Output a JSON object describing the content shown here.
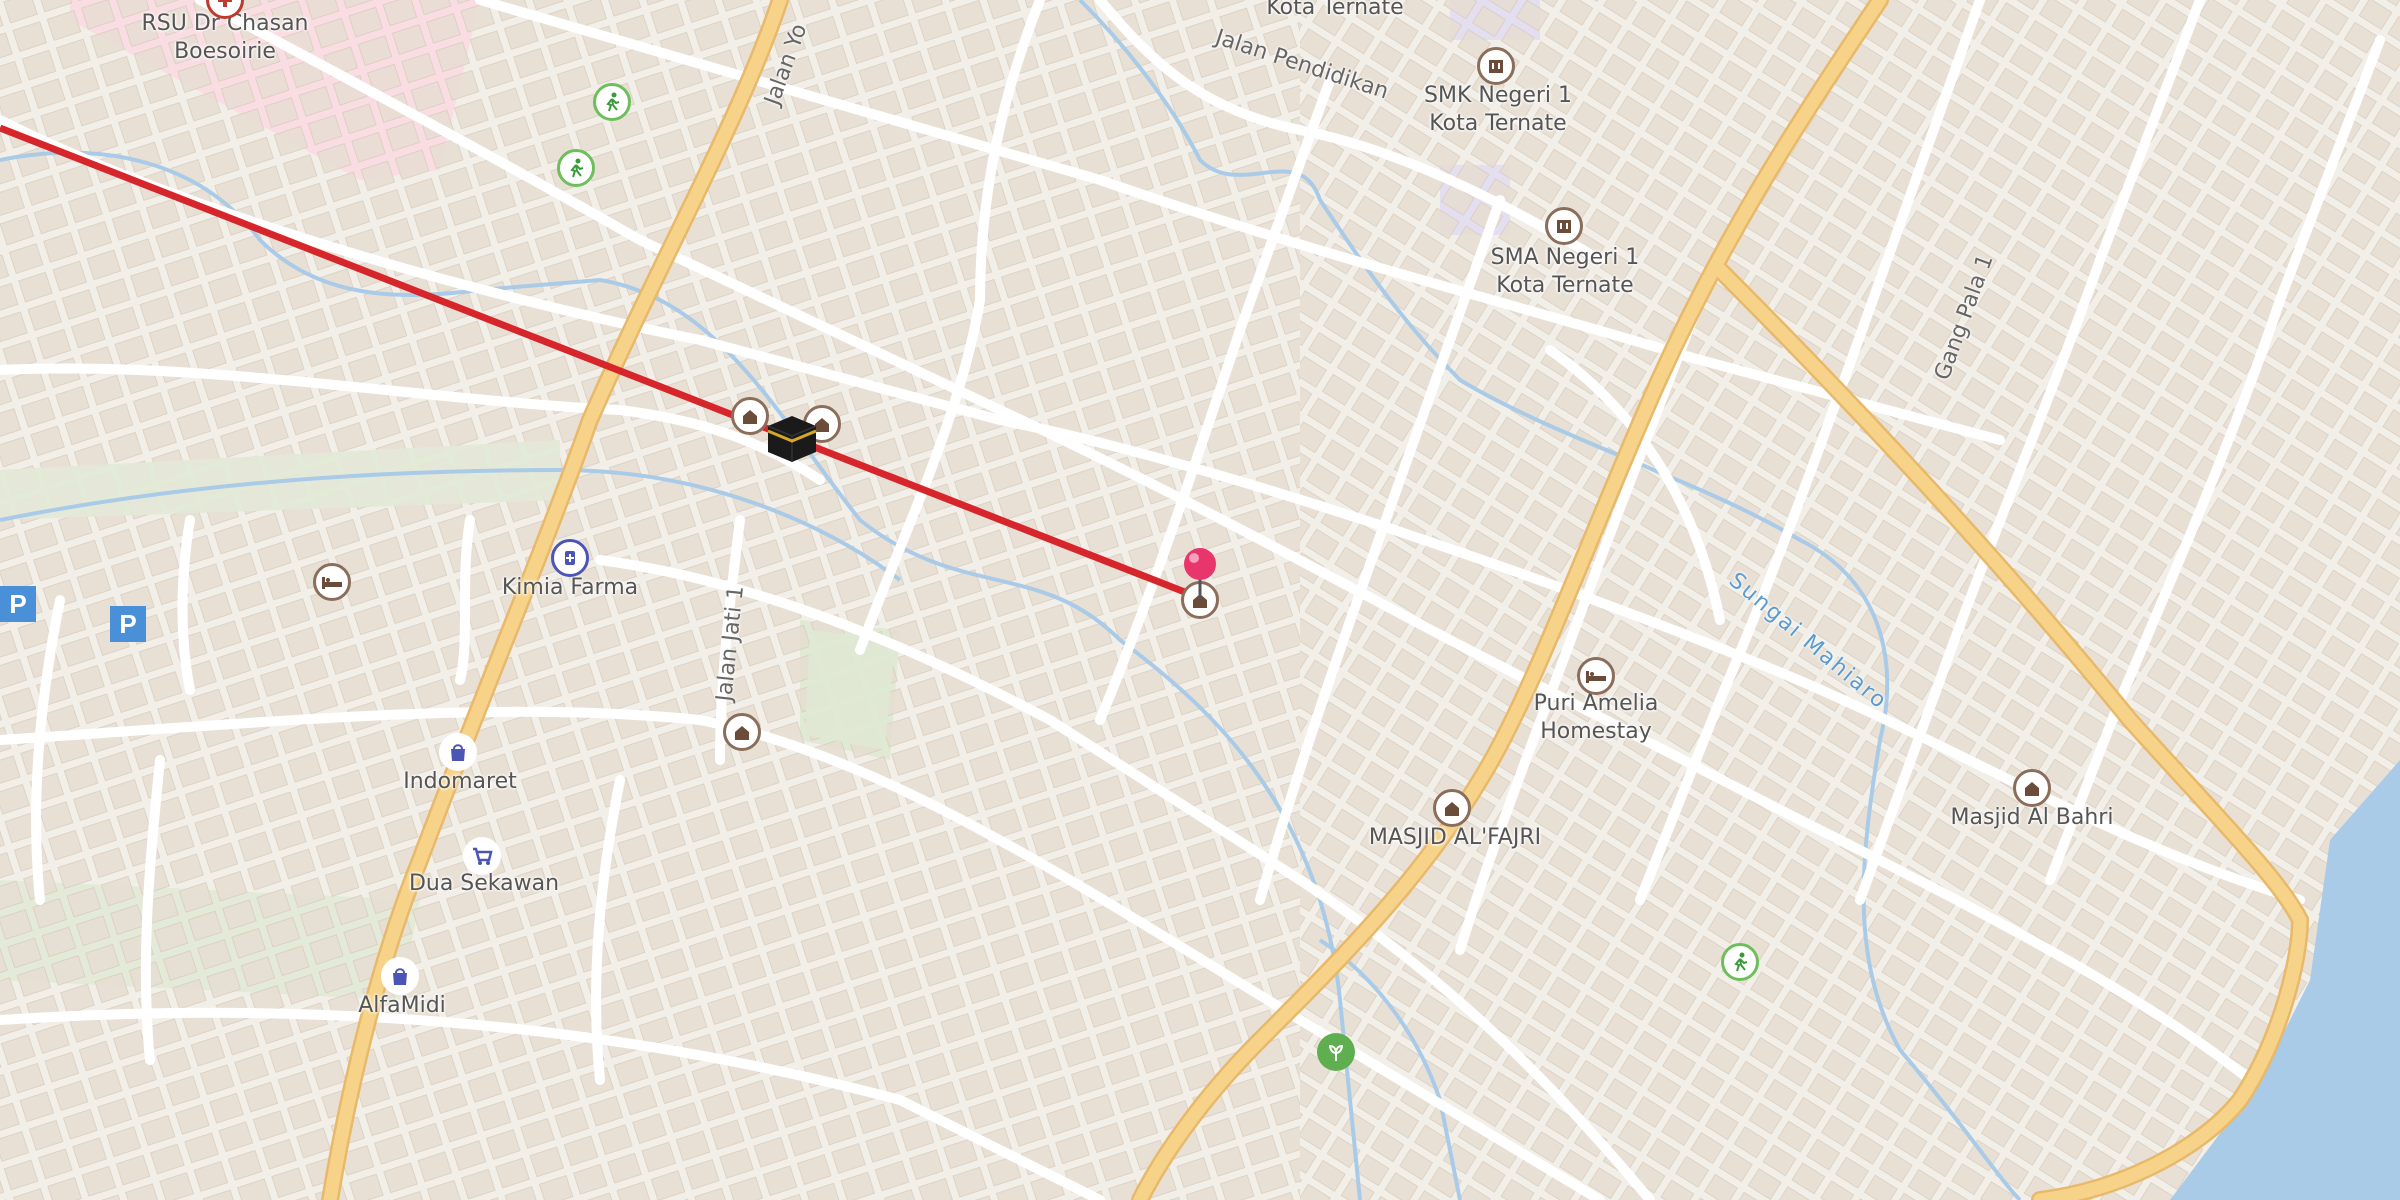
{
  "map": {
    "colors": {
      "land": "#f2efe9",
      "building": "#e6ddd2",
      "road_main": "#f7d38a",
      "road_minor": "#ffffff",
      "water": "#a9cbe8",
      "sea": "#a9cbe8",
      "qibla_line": "#d7262b",
      "pin": "#e8356b"
    },
    "labels": [
      {
        "id": "rsu",
        "text": "RSU Dr Chasan\nBoesoirie"
      },
      {
        "id": "kota-ternate-top",
        "text": "Kota Ternate"
      },
      {
        "id": "smk",
        "text": "SMK Negeri 1\nKota Ternate"
      },
      {
        "id": "sma",
        "text": "SMA Negeri 1\nKota Ternate"
      },
      {
        "id": "kimia-farma",
        "text": "Kimia Farma"
      },
      {
        "id": "indomaret",
        "text": "Indomaret"
      },
      {
        "id": "dua-sekawan",
        "text": "Dua Sekawan"
      },
      {
        "id": "alfamidi",
        "text": "AlfaMidi"
      },
      {
        "id": "puri-amelia",
        "text": "Puri Amelia\nHomestay"
      },
      {
        "id": "masjid-alfajri",
        "text": "MASJID AL'FAJRI"
      },
      {
        "id": "masjid-albahri",
        "text": "Masjid Al Bahri"
      }
    ],
    "streets": [
      {
        "id": "jalan-yos",
        "text": "Jalan Yo"
      },
      {
        "id": "jalan-pendidikan",
        "text": "Jalan Pendidikan"
      },
      {
        "id": "jalan-jati",
        "text": "Jalan Jati 1"
      },
      {
        "id": "gang-pala",
        "text": "Gang Pala 1"
      },
      {
        "id": "sungai",
        "text": "Sungai Mahiaro"
      }
    ],
    "icons": {
      "parking": "P",
      "qibla": "kaaba-icon",
      "pin": "location-pin-icon"
    }
  }
}
